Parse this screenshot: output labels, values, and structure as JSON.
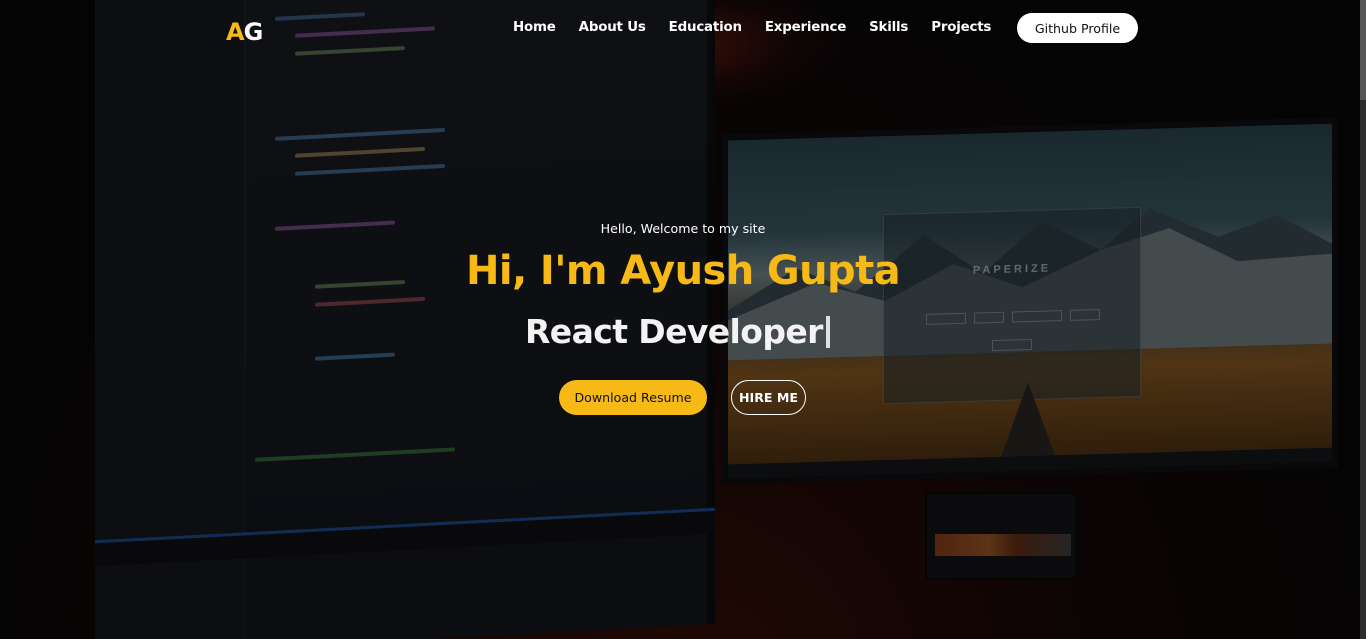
{
  "brand": {
    "logo_first": "A",
    "logo_second": "G"
  },
  "nav": {
    "links": [
      "Home",
      "About Us",
      "Education",
      "Experience",
      "Skills",
      "Projects"
    ],
    "cta_label": "Github Profile"
  },
  "hero": {
    "welcome": "Hello, Welcome to my site",
    "name": "Hi, I'm Ayush Gupta",
    "role": "React Developer",
    "primary_button": "Download Resume",
    "secondary_button": "HIRE ME"
  },
  "background": {
    "description_icon": "desk-setup-background",
    "monitor_app_title": "PAPERIZE"
  },
  "colors": {
    "accent": "#f7b916",
    "text": "#ffffff",
    "overlay": "#000000"
  }
}
